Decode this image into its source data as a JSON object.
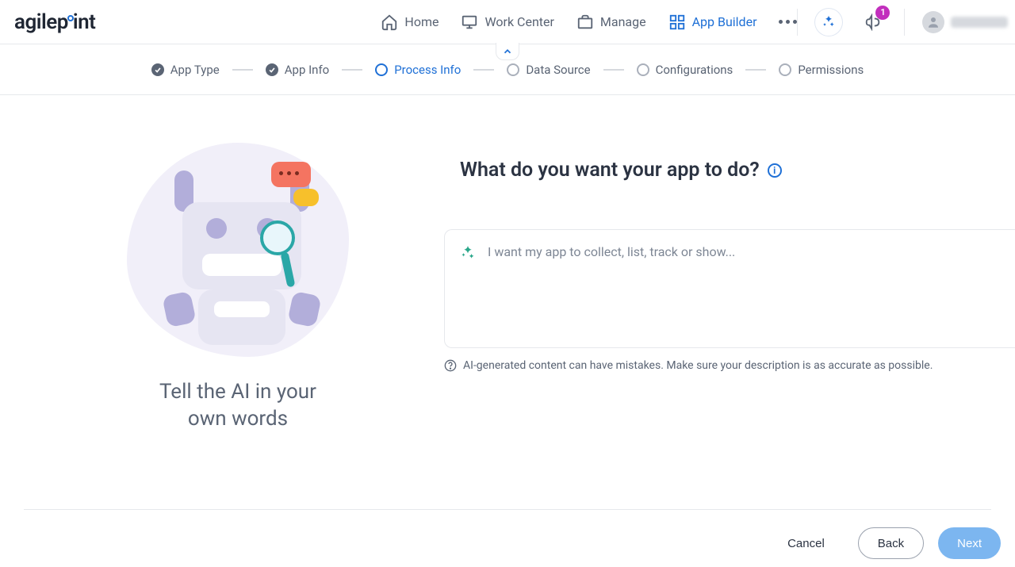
{
  "brand": "agilepoint",
  "nav": {
    "home": "Home",
    "work_center": "Work Center",
    "manage": "Manage",
    "app_builder": "App Builder"
  },
  "notifications": {
    "badge": "1"
  },
  "stepper": {
    "app_type": "App Type",
    "app_info": "App Info",
    "process_info": "Process Info",
    "data_source": "Data Source",
    "configurations": "Configurations",
    "permissions": "Permissions"
  },
  "illustration": {
    "caption_line1": "Tell the AI in your",
    "caption_line2": "own words"
  },
  "form": {
    "heading": "What do you want your app to do?",
    "placeholder": "I want my app to collect, list, track or show...",
    "disclaimer": "AI-generated content can have mistakes. Make sure your description is as accurate as possible."
  },
  "footer": {
    "cancel": "Cancel",
    "back": "Back",
    "next": "Next"
  }
}
